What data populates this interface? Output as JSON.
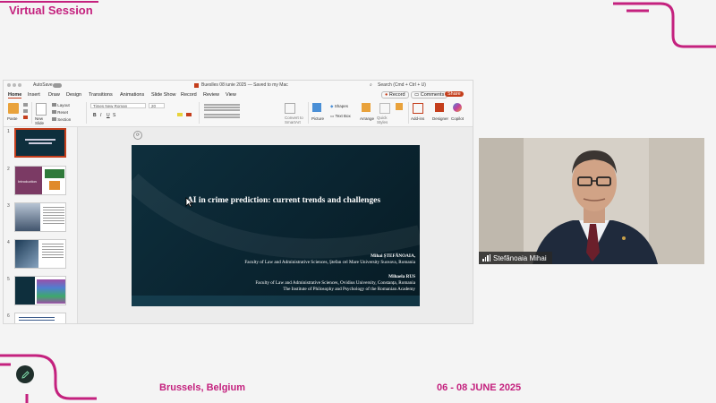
{
  "event": {
    "session_title": "Virtual Session",
    "city": "Brussels, Belgium",
    "dates": "06 - 08 JUNE 2025",
    "accent_color": "#c4217e"
  },
  "ppt": {
    "autosave_label": "AutoSave",
    "doc_title": "Bueslles 08 iunie 2025 — Saved to my Mac",
    "search_placeholder": "Search (Cmd + Ctrl + U)",
    "menu": [
      "Home",
      "Insert",
      "Draw",
      "Design",
      "Transitions",
      "Animations",
      "Slide Show",
      "Record",
      "Review",
      "View"
    ],
    "record_label": "Record",
    "comments_label": "Comments",
    "share_label": "Share",
    "ribbon": {
      "paste": "Paste",
      "new_slide": "New Slide",
      "layout": "Layout",
      "reset": "Reset",
      "section": "Section",
      "font_name": "Times New Roman",
      "font_size": "20",
      "convert_smartart": "Convert to SmartArt",
      "picture": "Picture",
      "shapes": "Shapes",
      "text_box": "Text Box",
      "arrange": "Arrange",
      "quick_styles": "Quick Styles",
      "addins": "Add-ins",
      "designer": "Designer",
      "copilot": "Copilot"
    },
    "thumbnails": [
      {
        "num": "1"
      },
      {
        "num": "2",
        "label": "Introduction"
      },
      {
        "num": "3"
      },
      {
        "num": "4"
      },
      {
        "num": "5"
      },
      {
        "num": "6"
      }
    ],
    "slide": {
      "title": "AI in crime prediction: current trends and challenges",
      "author1": "Mihai ȘTEFĂNOAIA,",
      "affil1": "Faculty of Law and Administrative Sciences, Ștefan cel Mare University Suceava, Romania",
      "author2": "Mihaela RUS",
      "affil2a": "Faculty of Law and Administrative Sciences, Ovidius University, Constanța, Romania",
      "affil2b": "The Institute of Philosophy and Psychology of the Romanian Academy"
    }
  },
  "video": {
    "participant_name": "Stefănoaia Mihai"
  }
}
